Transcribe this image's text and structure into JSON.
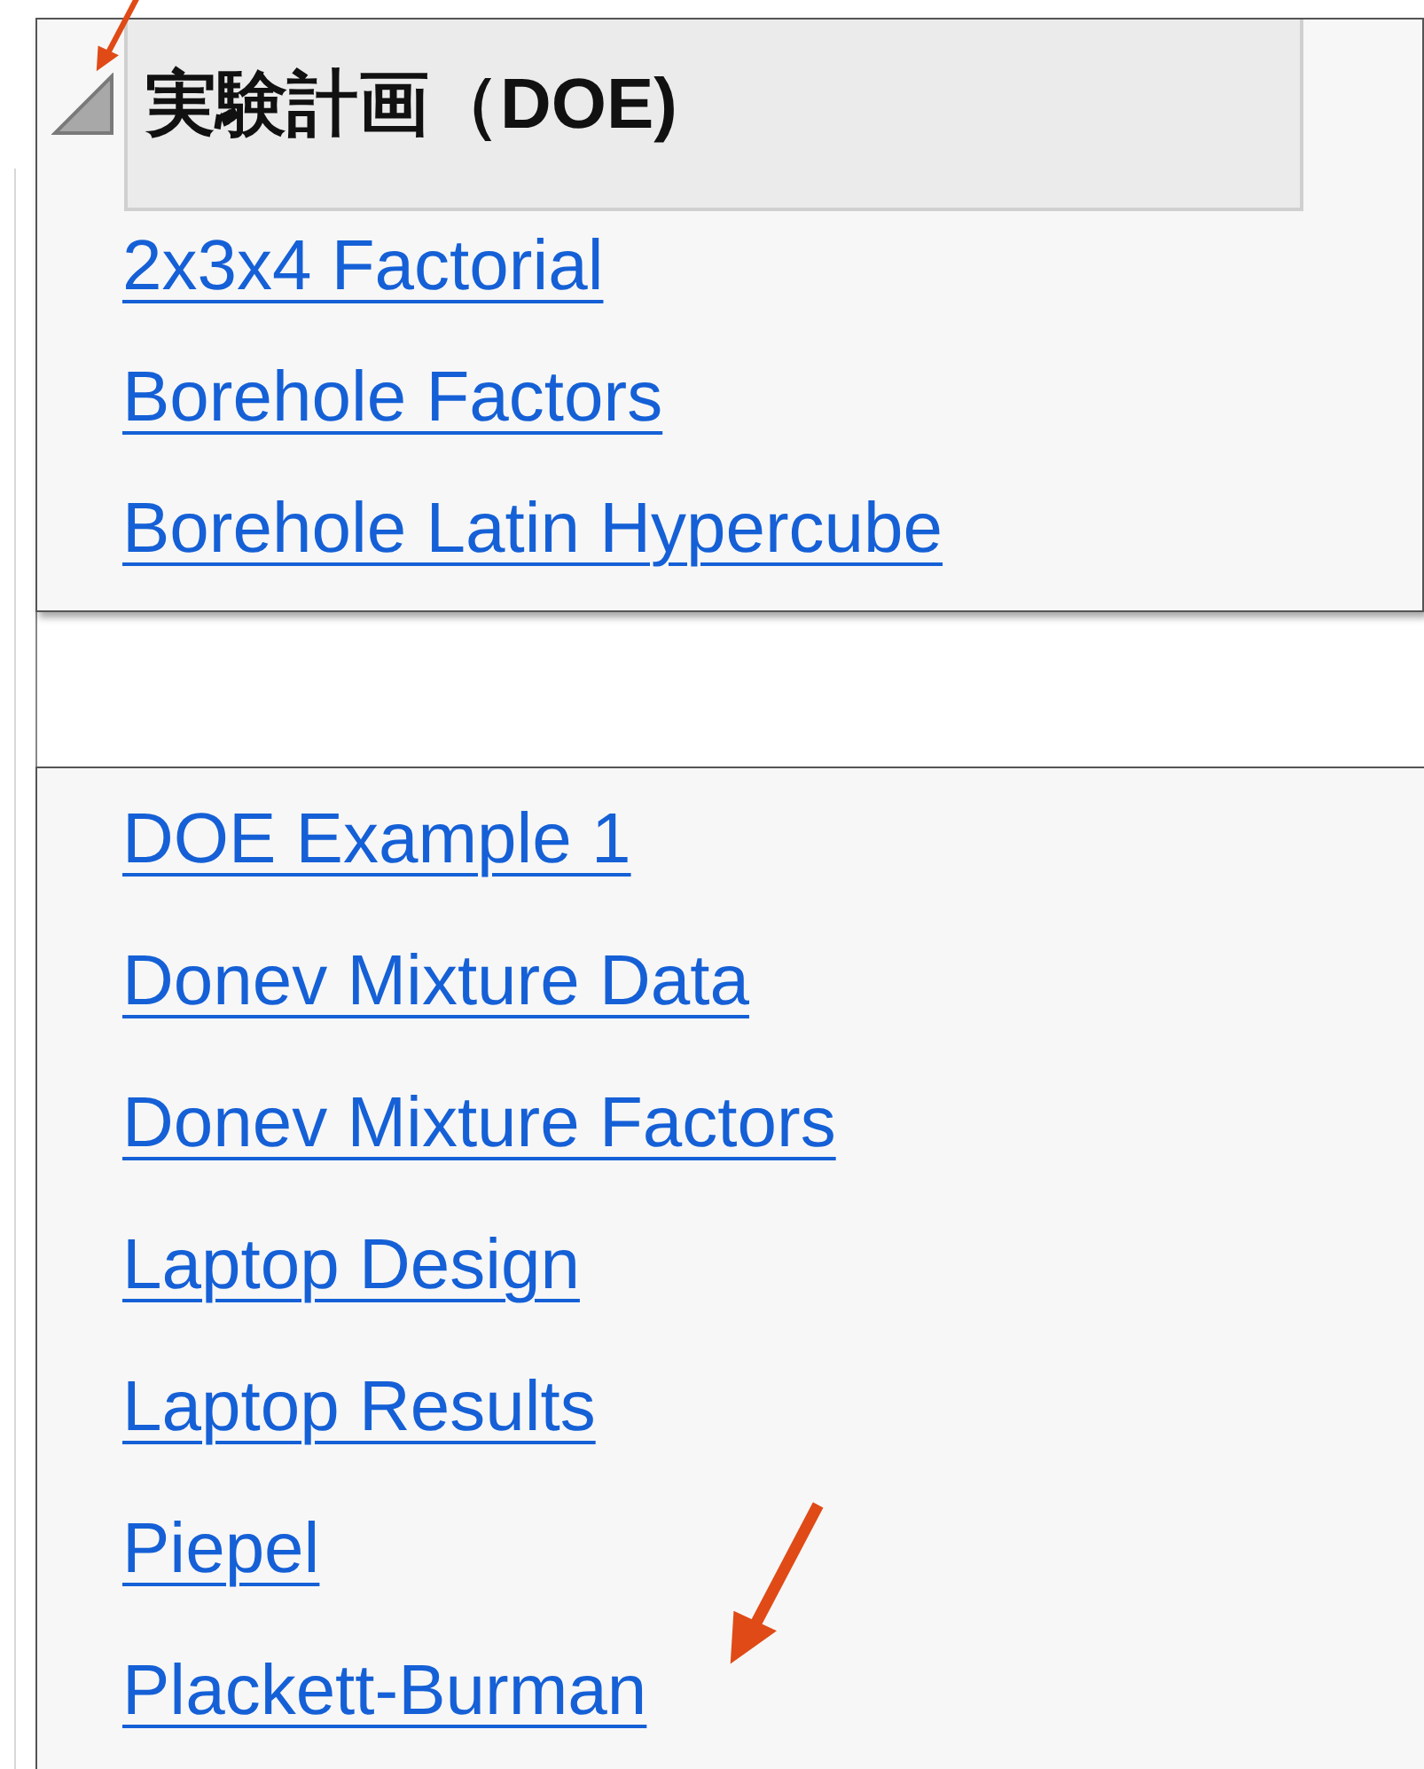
{
  "outline": {
    "title": "実験計画（DOE)",
    "expanded": true,
    "links_top": [
      "2x3x4 Factorial",
      "Borehole Factors",
      "Borehole Latin Hypercube"
    ],
    "links_bottom": [
      "DOE Example 1",
      "Donev Mixture Data",
      "Donev Mixture Factors",
      "Laptop Design",
      "Laptop Results",
      "Piepel",
      "Plackett-Burman"
    ]
  }
}
